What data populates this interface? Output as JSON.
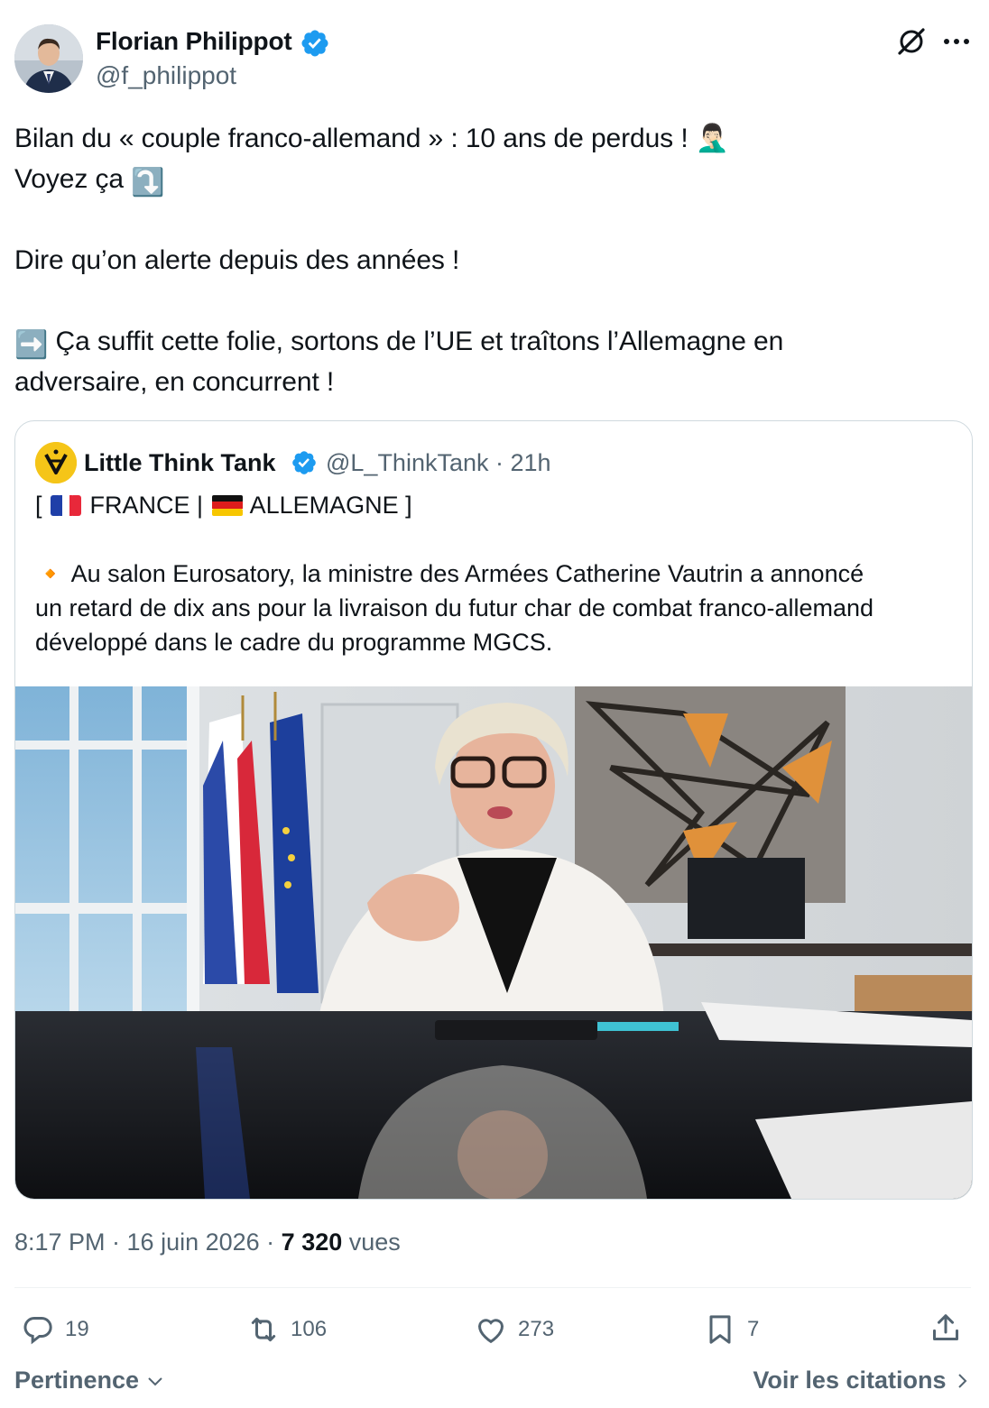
{
  "author": {
    "name": "Florian Philippot",
    "handle": "@f_philippot"
  },
  "tweet": {
    "line1": "Bilan du « couple franco-allemand » : 10 ans de perdus ! 🤦🏻‍♂️",
    "line2_text": "Voyez ça",
    "line2_emoji": "⤵️",
    "line3": "Dire qu’on alerte depuis des années !",
    "line4_emoji": "➡️",
    "line4_text": "Ça suffit cette folie, sortons de l’UE et traîtons l’Allemagne en",
    "line5": "adversaire, en concurrent !"
  },
  "quote": {
    "name": "Little Think Tank",
    "handle_time": "@L_ThinkTank · 21h",
    "header_open": "[",
    "header_france": "FRANCE |",
    "header_germany": "ALLEMAGNE ]",
    "bullet": "🔸",
    "body_line1": "Au salon Eurosatory, la ministre des Armées Catherine Vautrin a annoncé",
    "body_line2": "un retard de dix ans pour la livraison du futur char de combat franco-allemand",
    "body_line3": "développé dans le cadre du programme MGCS."
  },
  "meta": {
    "time_date": "8:17 PM · 16 juin 2026 · ",
    "views_count": "7 320",
    "views_label": " vues"
  },
  "actions": {
    "replies": "19",
    "reposts": "106",
    "likes": "273",
    "bookmarks": "7"
  },
  "footer": {
    "sort_label": "Pertinence",
    "quotes_label": "Voir les citations"
  },
  "colors": {
    "text": "#0f1419",
    "secondary": "#536471",
    "verified": "#1d9bf0",
    "border": "#cfd9de"
  }
}
